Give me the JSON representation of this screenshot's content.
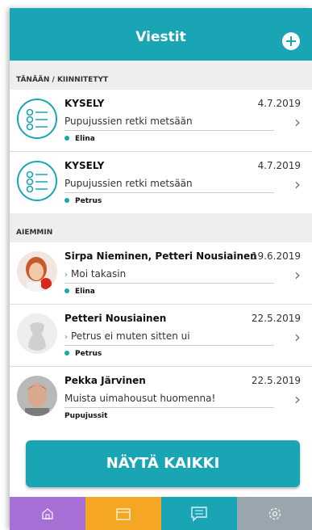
{
  "header": {
    "title": "Viestit"
  },
  "sections": {
    "today": "TÄNÄÄN / KIINNITETYT",
    "earlier": "AIEMMIN"
  },
  "messages": [
    {
      "title": "KYSELY",
      "date": "4.7.2019",
      "subtitle": "Pupujussien retki metsään",
      "sender": "Elina"
    },
    {
      "title": "KYSELY",
      "date": "4.7.2019",
      "subtitle": "Pupujussien retki metsään",
      "sender": "Petrus"
    },
    {
      "title": "Sirpa Nieminen, Petteri Nousiainen",
      "date": "19.6.2019",
      "subtitle": "Moi takasin",
      "sender": "Elina"
    },
    {
      "title": "Petteri Nousiainen",
      "date": "22.5.2019",
      "subtitle": "Petrus ei muten sitten ui",
      "sender": "Petrus"
    },
    {
      "title": "Pekka Järvinen",
      "date": "22.5.2019",
      "subtitle": "Muista uimahousut huomenna!",
      "sender": "Pupujussit"
    }
  ],
  "show_all_label": "NÄYTÄ KAIKKI",
  "tabs": [
    {
      "icon": "home-icon",
      "color": "#a56fd6"
    },
    {
      "icon": "calendar-icon",
      "color": "#f5a623"
    },
    {
      "icon": "messages-icon",
      "color": "#1aa5b5"
    },
    {
      "icon": "settings-icon",
      "color": "#9aa6ad"
    }
  ],
  "colors": {
    "accent": "#1aa5b5"
  }
}
